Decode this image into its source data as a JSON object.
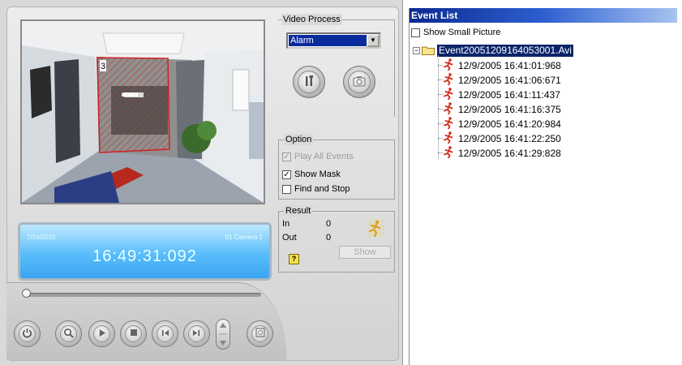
{
  "player": {
    "time_display": {
      "date": "7/16/2010",
      "camera": "01 Camera 1",
      "time": "16:49:31:092"
    },
    "video_process": {
      "label": "Video Process",
      "selected": "Alarm",
      "setup_button_icon": "tools-icon",
      "snapshot_button_icon": "camera-icon"
    },
    "option": {
      "label": "Option",
      "play_all_events": "Play All Events",
      "play_all_events_checked": true,
      "play_all_events_enabled": false,
      "show_mask": "Show Mask",
      "show_mask_checked": true,
      "find_and_stop": "Find and Stop",
      "find_and_stop_checked": false
    },
    "result": {
      "label": "Result",
      "in_label": "In",
      "in_value": "0",
      "out_label": "Out",
      "out_value": "0",
      "show_button": "Show"
    },
    "controls": [
      "power-icon",
      "zoom-icon",
      "play-icon",
      "stop-icon",
      "previous-icon",
      "next-icon",
      "speed-icon",
      "snapshot-icon"
    ],
    "seek_position": 0
  },
  "event_list": {
    "title": "Event List",
    "show_small_picture": "Show Small Picture",
    "show_small_picture_checked": false,
    "root": "Event20051209164053001.Avi",
    "events": [
      "12/9/2005 16:41:01:968",
      "12/9/2005 16:41:06:671",
      "12/9/2005 16:41:11:437",
      "12/9/2005 16:41:16:375",
      "12/9/2005 16:41:20:984",
      "12/9/2005 16:41:22:250",
      "12/9/2005 16:41:29:828"
    ]
  },
  "colors": {
    "title_bar": "#0b2a8f",
    "selection": "#0a246a",
    "display_blue": "#59bdfb",
    "event_icon": "#d42a1a"
  }
}
